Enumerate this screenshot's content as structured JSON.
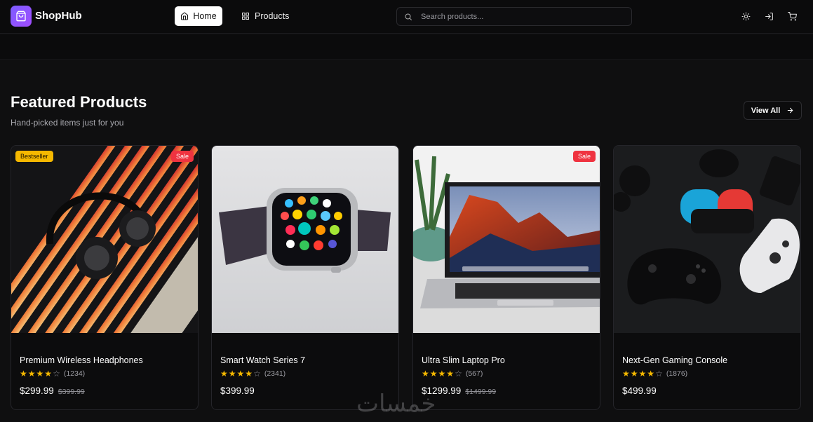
{
  "brand": {
    "name": "ShopHub",
    "accent": "#8b5cf6"
  },
  "nav": {
    "home_label": "Home",
    "products_label": "Products",
    "search_placeholder": "Search products...",
    "icons": [
      "sun-icon",
      "login-icon",
      "cart-icon"
    ]
  },
  "section": {
    "title": "Featured Products",
    "subtitle": "Hand-picked items just for you",
    "view_all_label": "View All"
  },
  "products": [
    {
      "name": "Premium Wireless Headphones",
      "rating": 4,
      "reviews": "(1234)",
      "price": "$299.99",
      "old_price": "$399.99",
      "badges": [
        "Bestseller",
        "Sale"
      ],
      "image": "headphones"
    },
    {
      "name": "Smart Watch Series 7",
      "rating": 4,
      "reviews": "(2341)",
      "price": "$399.99",
      "old_price": "",
      "badges": [],
      "image": "smartwatch"
    },
    {
      "name": "Ultra Slim Laptop Pro",
      "rating": 4,
      "reviews": "(567)",
      "price": "$1299.99",
      "old_price": "$1499.99",
      "badges": [
        "Sale"
      ],
      "image": "laptop"
    },
    {
      "name": "Next-Gen Gaming Console",
      "rating": 4,
      "reviews": "(1876)",
      "price": "$499.99",
      "old_price": "",
      "badges": [],
      "image": "controllers"
    }
  ],
  "colors": {
    "badge_bestseller": "#f5b800",
    "badge_sale": "#ef3340",
    "star": "#f5b800"
  },
  "watermark": "خمسات"
}
